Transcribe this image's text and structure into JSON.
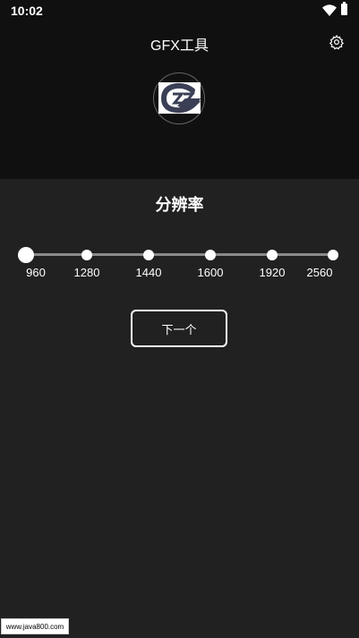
{
  "status_bar": {
    "time": "10:02"
  },
  "header": {
    "title": "GFX工具",
    "settings_icon": "gear-icon",
    "logo_icon": "app-logo"
  },
  "resolution": {
    "title": "分辨率",
    "options": [
      "960",
      "1280",
      "1440",
      "1600",
      "1920",
      "2560"
    ],
    "selected": "960"
  },
  "actions": {
    "next_label": "下一个"
  },
  "watermark": {
    "text": "www.java800.com"
  },
  "colors": {
    "header_bg": "#101010",
    "body_bg": "#212121",
    "track": "#8a8a8a",
    "foreground": "#ffffff"
  }
}
